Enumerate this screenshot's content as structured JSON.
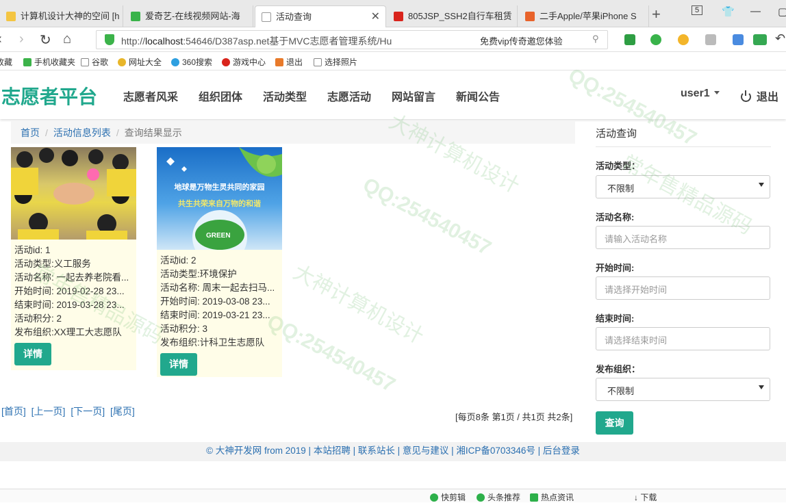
{
  "browser": {
    "tabs": [
      {
        "title": "计算机设计大神的空间 [h",
        "active": false
      },
      {
        "title": "爱奇艺-在线视频网站-海",
        "active": false
      },
      {
        "title": "活动查询",
        "active": true
      },
      {
        "title": "805JSP_SSH2自行车租赁",
        "active": false
      },
      {
        "title": "二手Apple/苹果iPhone S",
        "active": false
      }
    ],
    "tab_count_badge": "5",
    "url_prefix": "http://",
    "url_host": "localhost",
    "url_rest": ":54646/D387asp.net基于MVC志愿者管理系统/Hu",
    "promo_text": "免费vip传奇邀您体验",
    "bookmarks": [
      "收藏",
      "手机收藏夹",
      "谷歌",
      "网址大全",
      "360搜索",
      "游戏中心",
      "退出",
      "选择照片"
    ]
  },
  "header": {
    "brand": "志愿者平台",
    "nav": [
      "志愿者风采",
      "组织团体",
      "活动类型",
      "志愿活动",
      "网站留言",
      "新闻公告"
    ],
    "user": "user1",
    "logout": "退出"
  },
  "breadcrumb": {
    "home": "首页",
    "list": "活动信息列表",
    "current": "查询结果显示",
    "separator": "/"
  },
  "cards": [
    {
      "id_line": "活动id: 1",
      "type_line": "活动类型:义工服务",
      "name_line": "活动名称: 一起去养老院看...",
      "start_line": "开始时间: 2019-02-28 23...",
      "end_line": "结束时间: 2019-03-28 23...",
      "points_line": "活动积分: 2",
      "org_line": "发布组织:XX理工大志愿队",
      "button": "详情"
    },
    {
      "poster_line1": "地球是万物生灵共同的家园",
      "poster_line2": "共生共荣来自万物的和谐",
      "poster_badge": "GREEN",
      "id_line": "活动id: 2",
      "type_line": "活动类型:环境保护",
      "name_line": "活动名称: 周末一起去扫马...",
      "start_line": "开始时间: 2019-03-08 23...",
      "end_line": "结束时间: 2019-03-21 23...",
      "points_line": "活动积分: 3",
      "org_line": "发布组织:计科卫生志愿队",
      "button": "详情"
    }
  ],
  "pager": {
    "first": "[首页]",
    "prev": "[上一页]",
    "next": "[下一页]",
    "last": "[尾页]",
    "info": "[每页8条 第1页 / 共1页 共2条]"
  },
  "sidebar": {
    "title": "活动查询",
    "type_label": "活动类型：",
    "type_value": "不限制",
    "name_label": "活动名称:",
    "name_placeholder": "请输入活动名称",
    "start_label": "开始时间:",
    "start_placeholder": "请选择开始时间",
    "end_label": "结束时间:",
    "end_placeholder": "请选择结束时间",
    "org_label": "发布组织：",
    "org_value": "不限制",
    "submit": "查询"
  },
  "footer": {
    "text": "© 大神开发网 from 2019 | 本站招聘 | 联系站长 | 意见与建议 | 湘ICP备0703346号 | 后台登录"
  },
  "statusbar": [
    "快剪辑",
    "头条推荐",
    "热点资讯",
    "下载"
  ],
  "watermarks": [
    "QQ:254540457",
    "大神计算机设计",
    "常年售精品源码"
  ],
  "colors": {
    "accent": "#21a88d",
    "link": "#2a6fb0",
    "card_bg": "#fffde8"
  }
}
